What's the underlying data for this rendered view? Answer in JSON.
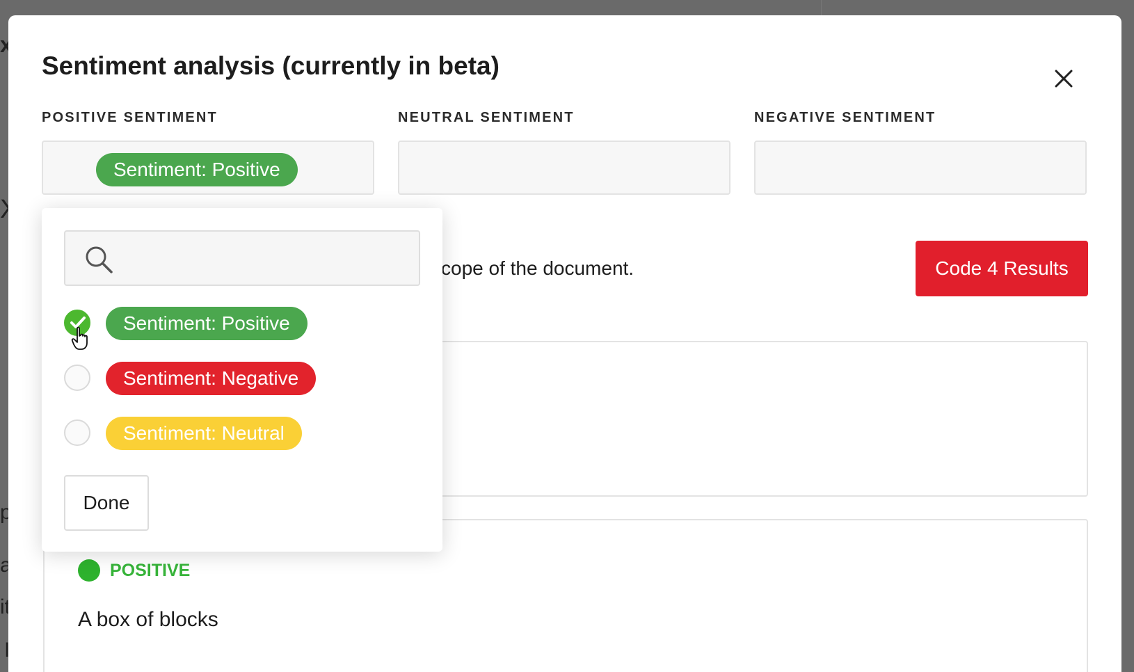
{
  "modal": {
    "title": "Sentiment analysis (currently in beta)",
    "close_label": "×"
  },
  "columns": [
    {
      "label": "POSITIVE SENTIMENT",
      "tag": "Sentiment: Positive"
    },
    {
      "label": "NEUTRAL SENTIMENT",
      "tag": ""
    },
    {
      "label": "NEGATIVE SENTIMENT",
      "tag": ""
    }
  ],
  "description": "cope of the document.",
  "code_button": "Code 4 Results",
  "dropdown": {
    "search_value": "",
    "options": [
      {
        "label": "Sentiment: Positive",
        "checked": true,
        "color": "#4ba74e"
      },
      {
        "label": "Sentiment: Negative",
        "checked": false,
        "color": "#e2232c"
      },
      {
        "label": "Sentiment: Neutral",
        "checked": false,
        "color": "#fad036"
      }
    ],
    "done_label": "Done"
  },
  "results": [
    {
      "status": "POSITIVE",
      "status_color": "#37b43a",
      "text": "A box of blocks"
    }
  ],
  "background_fragments": [
    "x",
    "X",
    "pe",
    "a",
    "it",
    "I"
  ],
  "colors": {
    "accent_red": "#e11f2c",
    "positive_green": "#4ba74e",
    "negative_red": "#e2232c",
    "neutral_yellow": "#fad036"
  }
}
